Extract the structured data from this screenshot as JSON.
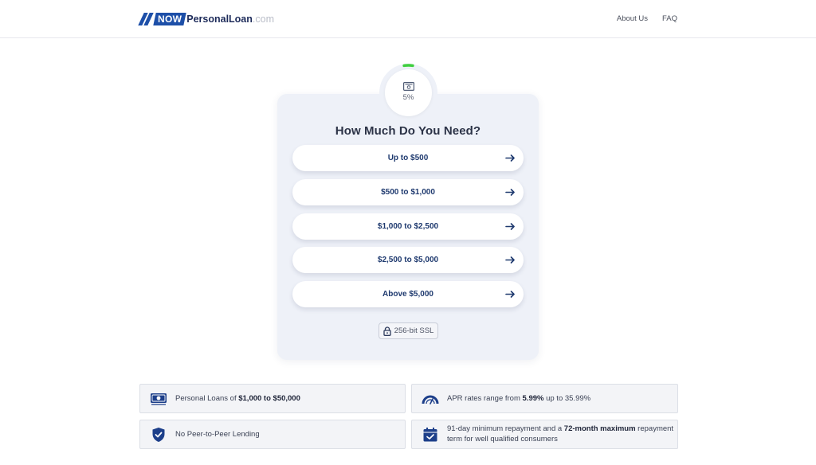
{
  "header": {
    "logo": {
      "now": "NOW",
      "brand": "PersonalLoan",
      "tld": ".com"
    },
    "nav": [
      {
        "label": "About Us"
      },
      {
        "label": "FAQ"
      }
    ]
  },
  "progress": {
    "percent_text": "5%",
    "value": 0.05,
    "icon": "money-icon"
  },
  "form": {
    "title": "How Much Do You Need?",
    "options": [
      {
        "label": "Up to $500"
      },
      {
        "label": "$500 to $1,000"
      },
      {
        "label": "$1,000 to $2,500"
      },
      {
        "label": "$2,500 to $5,000"
      },
      {
        "label": "Above $5,000"
      }
    ],
    "ssl_label": "256-bit SSL"
  },
  "features": [
    {
      "icon": "money-icon",
      "prefix": "Personal Loans of ",
      "bold": "$1,000 to $50,000",
      "suffix": ""
    },
    {
      "icon": "gauge-icon",
      "prefix": "APR rates range from ",
      "bold": "5.99%",
      "suffix": " up to 35.99%"
    },
    {
      "icon": "shield-check-icon",
      "prefix": "No Peer-to-Peer Lending",
      "bold": "",
      "suffix": ""
    },
    {
      "icon": "calendar-check-icon",
      "prefix": "91-day minimum repayment and a ",
      "bold": "72-month maximum",
      "suffix": " repayment term for well qualified consumers"
    }
  ],
  "colors": {
    "brand_blue": "#1d4fa8",
    "progress_green": "#3ecf3e",
    "card_bg": "#eef1f8",
    "option_text": "#1f3a6f"
  }
}
